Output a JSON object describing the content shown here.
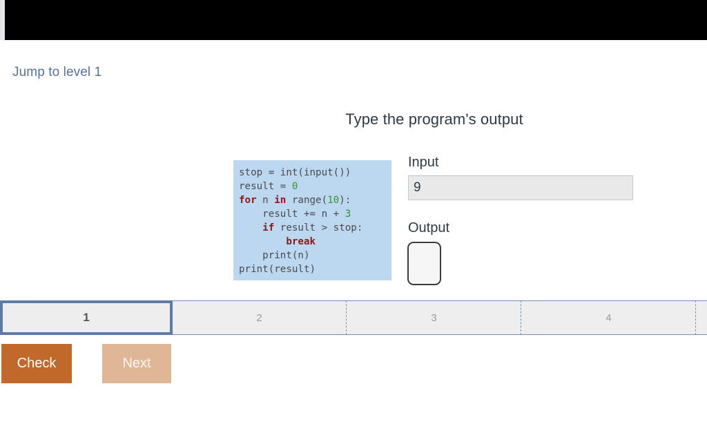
{
  "top_bar": {
    "present": true
  },
  "nav": {
    "jump_link": "Jump to level 1"
  },
  "header": {
    "title": "Type the program's output"
  },
  "code": {
    "language": "python",
    "lines": [
      "stop = int(input())",
      "result = 0",
      "for n in range(10):",
      "    result += n + 3",
      "    if result > stop:",
      "        break",
      "    print(n)",
      "print(result)"
    ],
    "keywords": [
      "for",
      "in",
      "if",
      "break"
    ],
    "numbers": [
      "0",
      "10",
      "3"
    ],
    "colors": {
      "background": "#bcd7f0",
      "text": "#4a4a4a",
      "keyword": "#8b1a14",
      "number": "#2e9434"
    }
  },
  "io": {
    "input_label": "Input",
    "input_value": "9",
    "input_placeholder": "",
    "output_label": "Output",
    "output_value": "",
    "output_placeholder": ""
  },
  "levels": {
    "items": [
      {
        "label": "1",
        "active": true
      },
      {
        "label": "2",
        "active": false
      },
      {
        "label": "3",
        "active": false
      },
      {
        "label": "4",
        "active": false
      },
      {
        "label": "",
        "active": false
      }
    ],
    "active_index": 0,
    "active_color": "#5c7ca6",
    "segment_color": "#7390b4"
  },
  "actions": {
    "check_label": "Check",
    "next_label": "Next",
    "check_color": "#c1692a",
    "next_color": "#dfb696"
  }
}
